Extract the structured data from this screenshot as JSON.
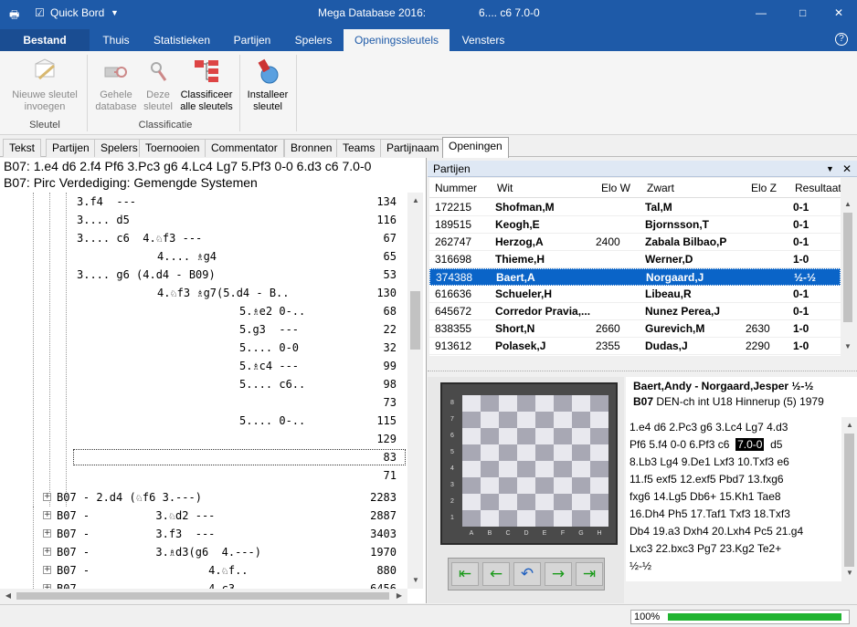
{
  "titlebar": {
    "app_title": "Mega Database 2016:",
    "doc_title": "6.... c6  7.0-0",
    "quick_label": "Quick Bord",
    "minimize": "—",
    "maximize": "□",
    "close": "✕"
  },
  "ribbon_tabs": [
    {
      "label": "Bestand"
    },
    {
      "label": "Thuis"
    },
    {
      "label": "Statistieken"
    },
    {
      "label": "Partijen"
    },
    {
      "label": "Spelers"
    },
    {
      "label": "Openingssleutels"
    },
    {
      "label": "Vensters"
    }
  ],
  "ribbon": {
    "new_key": {
      "line1": "Nieuwe sleutel",
      "line2": "invoegen"
    },
    "whole_db": {
      "line1": "Gehele",
      "line2": "database"
    },
    "this_key": {
      "line1": "Deze",
      "line2": "sleutel"
    },
    "classify_all": {
      "line1": "Classificeer",
      "line2": "alle sleutels"
    },
    "install_key": {
      "line1": "Installeer",
      "line2": "sleutel"
    },
    "group_sleutel": "Sleutel",
    "group_classificatie": "Classificatie"
  },
  "doc_tabs": [
    {
      "label": "Tekst"
    },
    {
      "label": "Partijen"
    },
    {
      "label": "Spelers"
    },
    {
      "label": "Toernooien"
    },
    {
      "label": "Commentator"
    },
    {
      "label": "Bronnen"
    },
    {
      "label": "Teams"
    },
    {
      "label": "Partijnaam"
    },
    {
      "label": "Openingen"
    }
  ],
  "left": {
    "line1": "B07: 1.e4 d6 2.f4 Pf6 3.Pc3 g6 4.Lc4 Lg7 5.Pf3 0-0 6.d3 c6 7.0-0",
    "line2": "B07: Pirc Verdediging: Gemengde Systemen",
    "tree": [
      {
        "text": "3.f4  ---",
        "count": "134"
      },
      {
        "text": "3.... d5",
        "count": "116"
      },
      {
        "text": "3.... c6  4.♘f3 ---",
        "count": "67"
      },
      {
        "text": "4.... ♗g4",
        "count": "65"
      },
      {
        "text": "3.... g6 (4.d4 - B09)",
        "count": "53"
      },
      {
        "text": "4.♘f3 ♗g7(5.d4 - B..",
        "count": "130"
      },
      {
        "text": "5.♗e2 0-..",
        "count": "68"
      },
      {
        "text": "5.g3  ---",
        "count": "22"
      },
      {
        "text": "5.... 0-0",
        "count": "32"
      },
      {
        "text": "5.♗c4 ---",
        "count": "99"
      },
      {
        "text": "5.... c6..",
        "count": "98"
      },
      {
        "text": "",
        "count": "73"
      },
      {
        "text": "5.... 0-..",
        "count": "115"
      },
      {
        "text": "",
        "count": "129"
      },
      {
        "text": "",
        "count": "83"
      },
      {
        "text": "",
        "count": "71"
      },
      {
        "text": "B07 - 2.d4 (♘f6 3.---)",
        "count": "2283"
      },
      {
        "text": "B07 -          3.♘d2 ---",
        "count": "2887"
      },
      {
        "text": "B07 -          3.f3  ---",
        "count": "3403"
      },
      {
        "text": "B07 -          3.♗d3(g6  4.---)",
        "count": "1970"
      },
      {
        "text": "B07 -                  4.♘f..",
        "count": "880"
      },
      {
        "text": "B07 -                  4.c3..",
        "count": "6456"
      }
    ]
  },
  "games_panel": {
    "title": "Partijen",
    "headers": {
      "nummer": "Nummer",
      "wit": "Wit",
      "elow": "Elo W",
      "zwart": "Zwart",
      "eloz": "Elo Z",
      "res": "Resultaat"
    },
    "rows": [
      {
        "nr": "172215",
        "white": "Shofman,M",
        "elow": "",
        "black": "Tal,M",
        "eloz": "",
        "res": "0-1"
      },
      {
        "nr": "189515",
        "white": "Keogh,E",
        "elow": "",
        "black": "Bjornsson,T",
        "eloz": "",
        "res": "0-1"
      },
      {
        "nr": "262747",
        "white": "Herzog,A",
        "elow": "2400",
        "black": "Zabala Bilbao,P",
        "eloz": "",
        "res": "0-1"
      },
      {
        "nr": "316698",
        "white": "Thieme,H",
        "elow": "",
        "black": "Werner,D",
        "eloz": "",
        "res": "1-0"
      },
      {
        "nr": "374388",
        "white": "Baert,A",
        "elow": "",
        "black": "Norgaard,J",
        "eloz": "",
        "res": "½-½"
      },
      {
        "nr": "616636",
        "white": "Schueler,H",
        "elow": "",
        "black": "Libeau,R",
        "eloz": "",
        "res": "0-1"
      },
      {
        "nr": "645672",
        "white": "Corredor Pravia,...",
        "elow": "",
        "black": "Nunez Perea,J",
        "eloz": "",
        "res": "0-1"
      },
      {
        "nr": "838355",
        "white": "Short,N",
        "elow": "2660",
        "black": "Gurevich,M",
        "eloz": "2630",
        "res": "1-0"
      },
      {
        "nr": "913612",
        "white": "Polasek,J",
        "elow": "2355",
        "black": "Dudas,J",
        "eloz": "2290",
        "res": "1-0"
      }
    ]
  },
  "game_info": {
    "players": "Baert,Andy - Norgaard,Jesper",
    "result": "½-½",
    "eco": "B07",
    "event": "DEN-ch int U18 Hinnerup (5) 1979"
  },
  "notation": {
    "l1": "1.e4  d6  2.Pc3  g6  3.Lc4  Lg7  4.d3",
    "l2a": "Pf6  5.f4  0-0  6.Pf3  c6",
    "current": "7.0-0",
    "l2b": "d5",
    "l3": "8.Lb3  Lg4  9.De1  Lxf3  10.Txf3  e6",
    "l4": "11.f5  exf5  12.exf5  Pbd7  13.fxg6",
    "l5": "fxg6  14.Lg5  Db6+  15.Kh1  Tae8",
    "l6": "16.Dh4  Ph5  17.Taf1  Txf3  18.Txf3",
    "l7": "Db4  19.a3  Dxh4  20.Lxh4  Pc5  21.g4",
    "l8": "Lxc3  22.bxc3  Pg7  23.Kg2  Te2+",
    "l9": "½-½"
  },
  "board": {
    "files": [
      "A",
      "B",
      "C",
      "D",
      "E",
      "F",
      "G",
      "H"
    ],
    "ranks": [
      "8",
      "7",
      "6",
      "5",
      "4",
      "3",
      "2",
      "1"
    ],
    "position": [
      [
        "",
        "",
        "",
        "",
        "",
        "",
        "",
        ""
      ],
      [
        "",
        "",
        "",
        "",
        "",
        "",
        "",
        ""
      ],
      [
        "",
        "",
        "",
        "",
        "",
        "",
        "",
        ""
      ],
      [
        "",
        "",
        "",
        "",
        "",
        "",
        "",
        ""
      ],
      [
        "",
        "",
        "",
        "",
        "",
        "",
        "",
        ""
      ],
      [
        "",
        "",
        "",
        "",
        "",
        "",
        "",
        ""
      ],
      [
        "",
        "",
        "",
        "",
        "",
        "",
        "",
        ""
      ],
      [
        "",
        "",
        "",
        "",
        "",
        "",
        "",
        ""
      ]
    ],
    "nav": {
      "first": "⇤",
      "prev": "←",
      "undo": "↶",
      "next": "→",
      "last": "⇥"
    }
  },
  "status": {
    "progress_text": "100%",
    "progress": 1.0
  },
  "colors": {
    "accent": "#1e5aa8",
    "selection": "#0a64c8",
    "progress": "#21b431"
  }
}
